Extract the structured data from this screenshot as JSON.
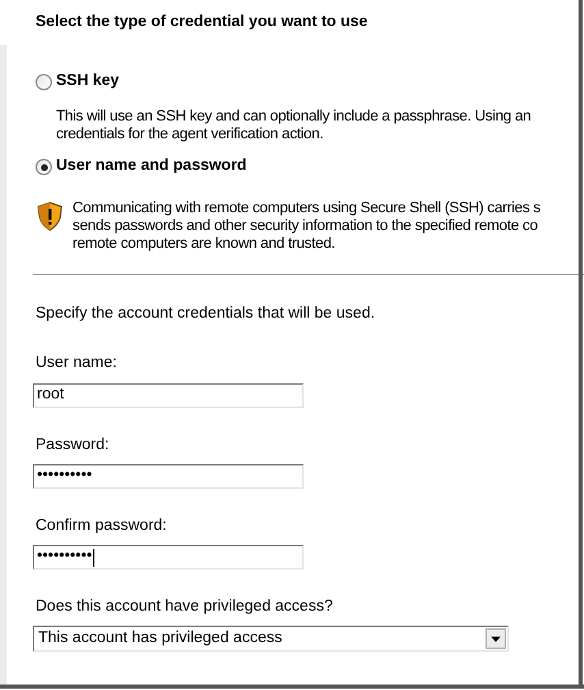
{
  "heading": "Select the type of credential you want to use",
  "options": [
    {
      "label": "SSH key",
      "selected": false,
      "kind": "plain",
      "lines": [
        "This will use an SSH key and can optionally include a passphrase. Using an",
        "credentials for the agent verification action."
      ]
    },
    {
      "label": "User name and password",
      "selected": true,
      "kind": "warning",
      "lines": [
        "Communicating with remote computers using Secure Shell (SSH) carries s",
        "sends passwords and other security information to the specified remote co",
        "remote computers are known and trusted."
      ]
    }
  ],
  "instruction": "Specify the account credentials that will be used.",
  "fields": [
    {
      "label": "User name:",
      "value": "root",
      "focused": false
    },
    {
      "label": "Password:",
      "value": "••••••••••",
      "focused": false
    },
    {
      "label": "Confirm password:",
      "value": "••••••••••",
      "focused": true
    }
  ],
  "privilege": {
    "label": "Does this account have privileged access?",
    "value": "This account has privileged access"
  }
}
